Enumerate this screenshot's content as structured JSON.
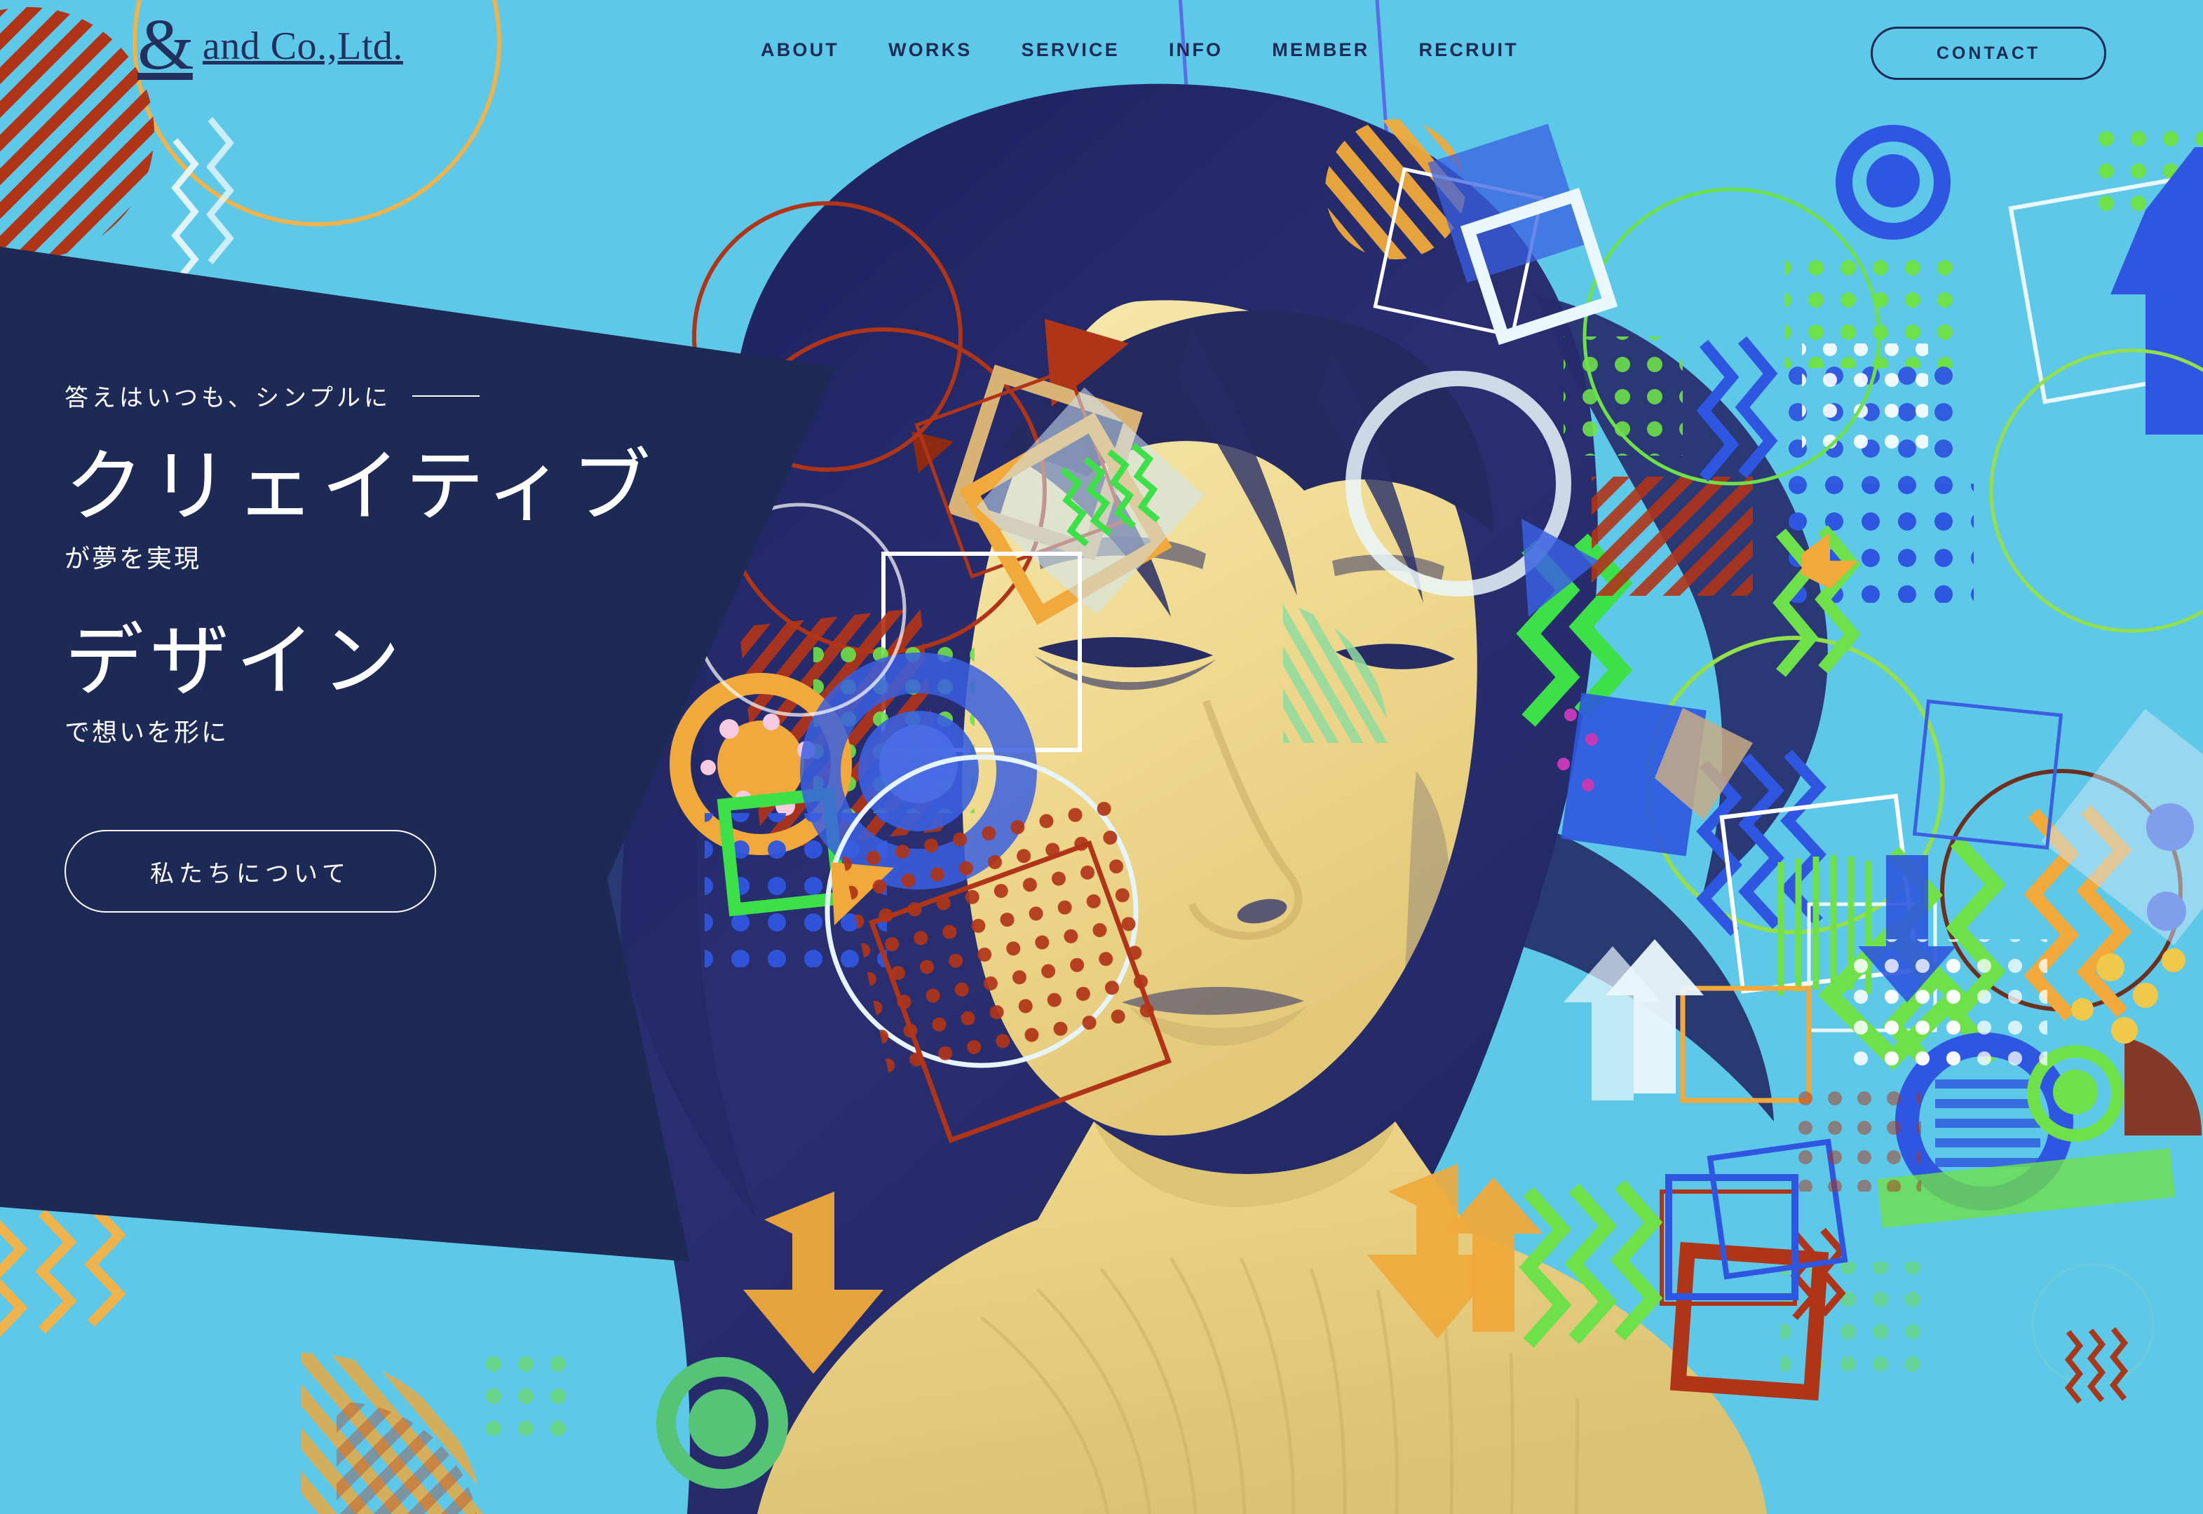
{
  "site": {
    "background_color": "#5ec8e8",
    "panel_color": "#1d2a55",
    "accent_navy": "#1d2a55",
    "accent_orange": "#f0a93a",
    "accent_red": "#b03418",
    "accent_green": "#5cc46a",
    "accent_blue": "#3a5fe0",
    "duotone_light": "#f2de96",
    "duotone_dark": "#2a2c6b"
  },
  "header": {
    "brand": {
      "ampersand": "&",
      "name": "and Co.,Ltd."
    },
    "nav": [
      {
        "label": "ABOUT"
      },
      {
        "label": "WORKS"
      },
      {
        "label": "SERVICE"
      },
      {
        "label": "INFO"
      },
      {
        "label": "MEMBER"
      },
      {
        "label": "RECRUIT"
      }
    ],
    "contact_button": "CONTACT"
  },
  "hero": {
    "tagline": "答えはいつも、シンプルに",
    "headline_1": "クリェイティブ",
    "subline_1": "が夢を実現",
    "headline_2": "デザイン",
    "subline_2": "で想いを形に",
    "cta_button": "私たちについて"
  }
}
